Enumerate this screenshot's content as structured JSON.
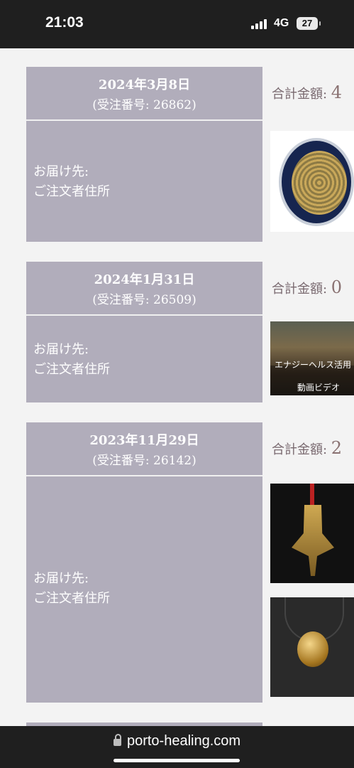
{
  "status_bar": {
    "time": "21:03",
    "network": "4G",
    "battery": "27"
  },
  "orders": [
    {
      "date": "2024年3月8日",
      "order_number": "(受注番号: 26862)",
      "delivery_label": "お届け先:",
      "delivery_value": "ご注文者住所",
      "total_label": "合計金額: ",
      "total_value": "4"
    },
    {
      "date": "2024年1月31日",
      "order_number": "(受注番号: 26509)",
      "delivery_label": "お届け先:",
      "delivery_value": "ご注文者住所",
      "total_label": "合計金額: ",
      "total_value": "0",
      "thumb_text_1": "エナジーヘルス活用",
      "thumb_text_2": "動画ビデオ"
    },
    {
      "date": "2023年11月29日",
      "order_number": "(受注番号: 26142)",
      "delivery_label": "お届け先:",
      "delivery_value": "ご注文者住所",
      "total_label": "合計金額: ",
      "total_value": "2"
    }
  ],
  "browser": {
    "url": "porto-healing.com"
  }
}
